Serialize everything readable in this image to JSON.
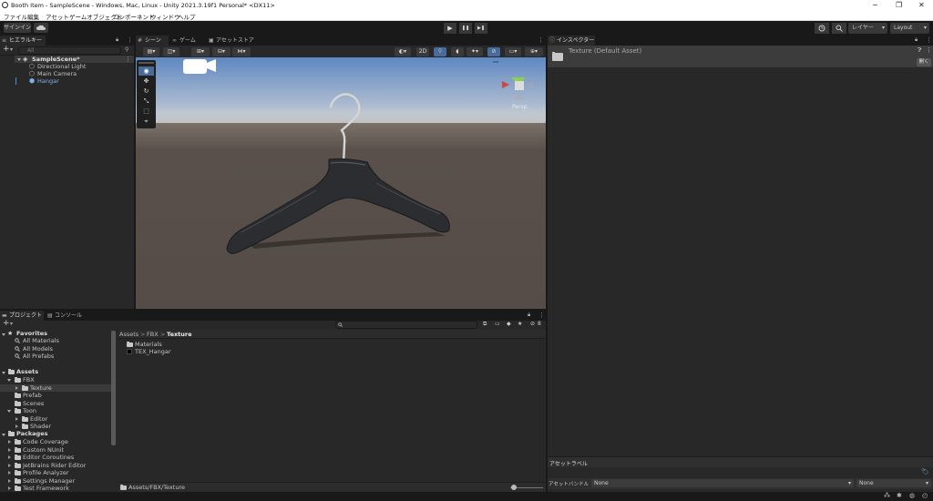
{
  "window": {
    "title": "Booth Item - SampleScene - Windows, Mac, Linux - Unity 2021.3.19f1 Personal* <DX11>",
    "minimize": "─",
    "maximize": "❐",
    "close": "✕"
  },
  "menu": [
    "ファイル",
    "編集",
    "アセット",
    "ゲームオブジェクト",
    "コンポーネント",
    "ウィンドウ",
    "ヘルプ"
  ],
  "toolbar": {
    "signin": "サインイン",
    "cloud_icon": "cloud-icon",
    "play": "▶",
    "pause": "❚❚",
    "step": "▶❚",
    "layers": "レイヤー",
    "layout": "Layout"
  },
  "hierarchy": {
    "tab": "ヒエラルキー",
    "add": "+",
    "search_placeholder": "All",
    "scene": "SampleScene*",
    "items": [
      "Directional Light",
      "Main Camera",
      "Hangar"
    ]
  },
  "scene": {
    "tabs": [
      "シーン",
      "ゲーム",
      "アセットストア"
    ],
    "mode_2d": "2D",
    "gizmo_label": "Persp",
    "colors": {
      "sky_top": "#5f88c2",
      "sky_bottom": "#c9ced4",
      "ground": "#59504b",
      "hanger": "#2b2d30"
    }
  },
  "inspector": {
    "tab": "インスペクター",
    "title": "Texture (Default Asset)",
    "open": "開く",
    "asset_label": "アセットラベル",
    "bundle_label": "アセットバンドル",
    "bundle_value": "None",
    "variant_value": "None"
  },
  "project": {
    "tabs": [
      "プロジェクト",
      "コンソール"
    ],
    "add": "+",
    "badge": "8",
    "favorites": {
      "label": "Favorites",
      "items": [
        "All Materials",
        "All Models",
        "All Prefabs"
      ]
    },
    "assets_label": "Assets",
    "tree": [
      {
        "label": "FBX",
        "depth": 1,
        "open": true
      },
      {
        "label": "Texture",
        "depth": 2,
        "open": false,
        "selected": true
      },
      {
        "label": "Prefab",
        "depth": 1
      },
      {
        "label": "Scenes",
        "depth": 1
      },
      {
        "label": "Toon",
        "depth": 1,
        "open": true
      },
      {
        "label": "Editor",
        "depth": 2,
        "open": false
      },
      {
        "label": "Shader",
        "depth": 2,
        "open": false
      }
    ],
    "packages_label": "Packages",
    "packages": [
      "Code Coverage",
      "Custom NUnit",
      "Editor Coroutines",
      "JetBrains Rider Editor",
      "Profile Analyzer",
      "Settings Manager",
      "Test Framework"
    ],
    "breadcrumb": [
      "Assets",
      "FBX",
      "Texture"
    ],
    "files": [
      {
        "label": "Materials",
        "kind": "folder"
      },
      {
        "label": "TEX_Hangar",
        "kind": "texture"
      }
    ],
    "footer_path": "Assets/FBX/Texture"
  }
}
